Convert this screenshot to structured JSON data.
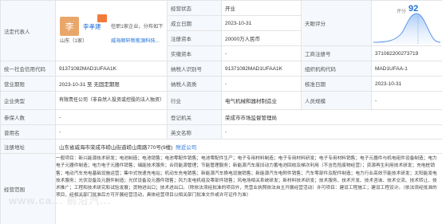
{
  "legal_rep": {
    "label": "法定代表人",
    "avatar_char": "李",
    "name": "李孝建",
    "role": "任职1家企业，分布如下",
    "province": "山东（1家）",
    "company": "威海顺轩新能源科技..."
  },
  "reg_status": {
    "label": "经营状态",
    "value": "开业"
  },
  "founded": {
    "label": "成立日期",
    "value": "2023-10-31"
  },
  "reg_capital": {
    "label": "注册资本",
    "value": "20000万人民币"
  },
  "paid_capital": {
    "label": "实缴资本",
    "value": "-"
  },
  "rating": {
    "label": "天眼评分",
    "score_label": "评分",
    "score": "92"
  },
  "biz_reg_no": {
    "label": "工商注册号",
    "value": "371082200273719"
  },
  "credit_code": {
    "label": "统一社会信用代码",
    "value": "91371082MAD1UFAA1K"
  },
  "taxpayer_id": {
    "label": "纳税人识别号",
    "value": "91371082MAD1UFAA1K"
  },
  "org_code": {
    "label": "组织机构代码",
    "value": "MAD1UFAA-1"
  },
  "term": {
    "label": "营业期限",
    "value": "2023-10-31 至 无固定期限"
  },
  "taxpayer_qual": {
    "label": "纳税人资质",
    "value": "-"
  },
  "approved_date": {
    "label": "核准日期",
    "value": "2023-10-31"
  },
  "company_type": {
    "label": "企业类型",
    "value": "有限责任公司（非自然人投资或控股的法人独资）"
  },
  "industry": {
    "label": "行业",
    "value": "电气机械和器材制造业"
  },
  "staff_size": {
    "label": "人员规模",
    "value": "-"
  },
  "insured": {
    "label": "参保人数",
    "value": "-"
  },
  "registrar": {
    "label": "登记机关",
    "value": "荣成市市场监督管理局"
  },
  "former_name": {
    "label": "曾用名",
    "value": "-"
  },
  "english_name": {
    "label": "英文名称",
    "value": "-"
  },
  "address": {
    "label": "注册地址",
    "value": "山东省威海市荣成市崂山街道崂山南路770号(9楼)",
    "link": "附近公司"
  },
  "scope": {
    "label": "经营范围",
    "text": "一般项目：新兴能源技术研发；电池制造；电池销售；电池零配件销售；电池零配件生产；电子专用材料制造；电子专用材料研发；电子专用材料销售；电子元器件与机电组件设备制造；电力电子元器件制造；电力电子元器件销售；储能技术服务；合同能源管理；节能管理服务；新能源汽车废旧动力蓄电池回收及梯次利用（不含危险废物经营）；资源再生利用技术研发；充电桩销售；电动汽车充电基础设施运营；集中式快速充电站；机动车充电销售；新能源汽车换电设施销售；新能源汽车电附件销售；汽车零部件及配件制造；电力行业高效节能技术研发；太阳能发电技术服务；光伏设备及元器件制造；光伏设备及元器件销售；风力发电机组及零部件销售；风电场相关系统研发；新材料技术研发；技术服务、技术开发、技术咨询、技术交流、技术转让、技术推广；工程和技术研究和试验发展；货物进出口；技术进出口。（除依法须经批准的项目外，凭营业执照依法自主开展经营活动）许可项目：建设工程施工；建设工程设计。（依法须经批准的项目，经相关部门批准后方可开展经营活动，具体经营项目以相关部门批准文件或许可证件为准）"
  },
  "watermark": "www.ca... 前沿汽..."
}
